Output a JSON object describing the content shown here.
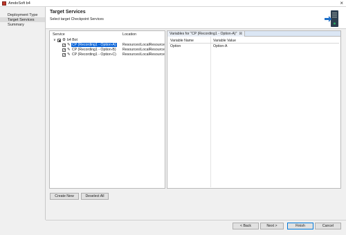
{
  "window": {
    "title": "AmdoSoft b4"
  },
  "sidebar": {
    "items": [
      {
        "label": "Deployment Type",
        "active": false
      },
      {
        "label": "Target Services",
        "active": true
      },
      {
        "label": "Summary",
        "active": false
      }
    ]
  },
  "header": {
    "title": "Target Services",
    "subtitle": "Select target Checkpoint Services"
  },
  "tree": {
    "columns": {
      "service": "Service",
      "location": "Location"
    },
    "root": {
      "label": "b4 Bot",
      "checked": "partial"
    },
    "items": [
      {
        "label": "CP (Recording1 - Option-A)",
        "location": "Resources\\LocalResource",
        "checked": true,
        "selected": true
      },
      {
        "label": "CP (Recording1 - Option-B)",
        "location": "Resources\\LocalResource",
        "checked": true,
        "selected": false
      },
      {
        "label": "CP (Recording1 - Option-C)",
        "location": "Resources\\LocalResource",
        "checked": true,
        "selected": false
      }
    ]
  },
  "variables": {
    "tab_label": "Variables for \"CP (Recording1 - Option-A)\"",
    "tab_close": "☒",
    "columns": {
      "name": "Variable Name",
      "value": "Variable Value"
    },
    "rows": [
      {
        "name": "Option",
        "value": "Option-A"
      }
    ]
  },
  "actions": {
    "create_new": "Create New",
    "deselect_all": "Deselect All"
  },
  "footer": {
    "back": "< Back",
    "next": "Next >",
    "finish": "Finish",
    "cancel": "Cancel"
  },
  "icons": {
    "app": "app-icon",
    "close": "close-icon",
    "bot": "bot-icon",
    "service": "wrench-icon",
    "logo": "server-deploy-icon"
  },
  "colors": {
    "selection": "#0a64d8",
    "primary_border": "#0078d7",
    "tab_background": "#dbe6f4"
  }
}
